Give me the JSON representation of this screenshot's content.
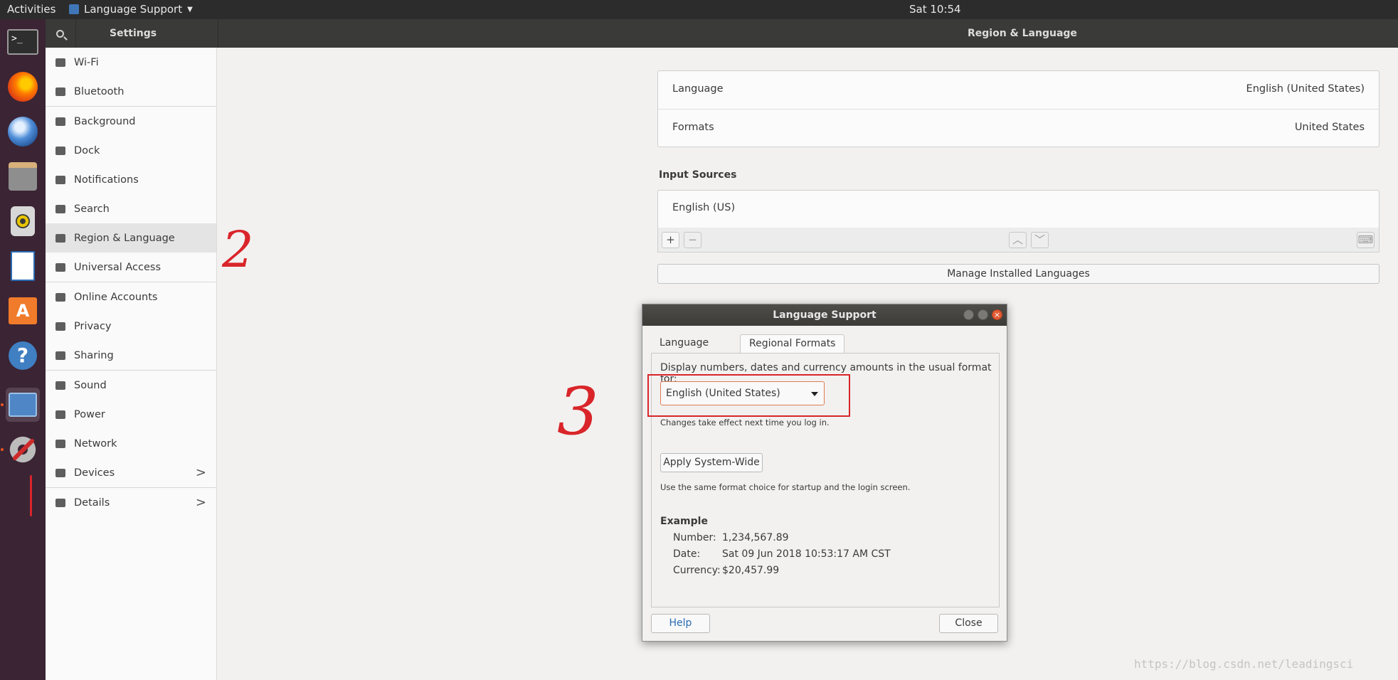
{
  "topbar": {
    "activities": "Activities",
    "app_menu": "Language Support",
    "clock": "Sat 10:54"
  },
  "dock": {
    "items": [
      {
        "name": "terminal",
        "icon": "terminal-icon"
      },
      {
        "name": "firefox",
        "icon": "firefox-icon"
      },
      {
        "name": "thunderbird",
        "icon": "thunderbird-icon"
      },
      {
        "name": "files",
        "icon": "files-icon"
      },
      {
        "name": "rhythmbox",
        "icon": "rhythmbox-icon"
      },
      {
        "name": "libreoffice-writer",
        "icon": "writer-icon"
      },
      {
        "name": "ubuntu-software",
        "icon": "software-store-icon"
      },
      {
        "name": "help",
        "icon": "help-icon"
      },
      {
        "name": "language-support",
        "icon": "language-support-icon",
        "active": true
      },
      {
        "name": "settings",
        "icon": "settings-icon",
        "running": true
      }
    ],
    "terminal_glyph": ">_",
    "store_glyph": "A",
    "help_glyph": "?"
  },
  "settings": {
    "header_left": "Settings",
    "header_right": "Region & Language",
    "sidebar": [
      {
        "label": "Wi-Fi",
        "icon": "wifi-icon"
      },
      {
        "label": "Bluetooth",
        "icon": "bluetooth-icon"
      },
      {
        "label": "Background",
        "icon": "background-icon"
      },
      {
        "label": "Dock",
        "icon": "dock-icon"
      },
      {
        "label": "Notifications",
        "icon": "bell-icon"
      },
      {
        "label": "Search",
        "icon": "search-icon"
      },
      {
        "label": "Region & Language",
        "icon": "region-icon",
        "selected": true
      },
      {
        "label": "Universal Access",
        "icon": "accessibility-icon"
      },
      {
        "label": "Online Accounts",
        "icon": "online-accounts-icon"
      },
      {
        "label": "Privacy",
        "icon": "hand-icon"
      },
      {
        "label": "Sharing",
        "icon": "share-icon"
      },
      {
        "label": "Sound",
        "icon": "speaker-icon"
      },
      {
        "label": "Power",
        "icon": "power-icon"
      },
      {
        "label": "Network",
        "icon": "network-icon"
      },
      {
        "label": "Devices",
        "icon": "devices-icon",
        "chevron": ">"
      },
      {
        "label": "Details",
        "icon": "info-icon",
        "chevron": ">"
      }
    ],
    "main": {
      "language_label": "Language",
      "language_value": "English (United States)",
      "formats_label": "Formats",
      "formats_value": "United States",
      "input_sources_heading": "Input Sources",
      "input_source": "English (US)",
      "add_btn": "+",
      "remove_btn": "−",
      "up_btn": "︿",
      "down_btn": "﹀",
      "keyboard_btn": "⌨",
      "manage_btn": "Manage Installed Languages"
    }
  },
  "dialog": {
    "title": "Language Support",
    "tabs": [
      "Language",
      "Regional Formats"
    ],
    "active_tab": "Regional Formats",
    "prompt": "Display numbers, dates and currency amounts in the usual format for:",
    "format_select": "English (United States)",
    "changes_note": "Changes take effect next time you log in.",
    "apply_btn": "Apply System-Wide",
    "apply_note": "Use the same format choice for startup and the login screen.",
    "example_heading": "Example",
    "example": {
      "number_label": "Number:",
      "number_value": "1,234,567.89",
      "date_label": "Date:",
      "date_value": "Sat 09 Jun 2018 10:53:17 AM CST",
      "currency_label": "Currency:",
      "currency_value": "$20,457.99"
    },
    "help_btn": "Help",
    "close_btn": "Close"
  },
  "annotations": {
    "step2": "2",
    "step3": "3"
  },
  "watermark": "https://blog.csdn.net/leadingsci",
  "colors": {
    "annotation_red": "#d9252a",
    "dock_bg": "#3b2434",
    "accent_orange": "#e95420"
  }
}
